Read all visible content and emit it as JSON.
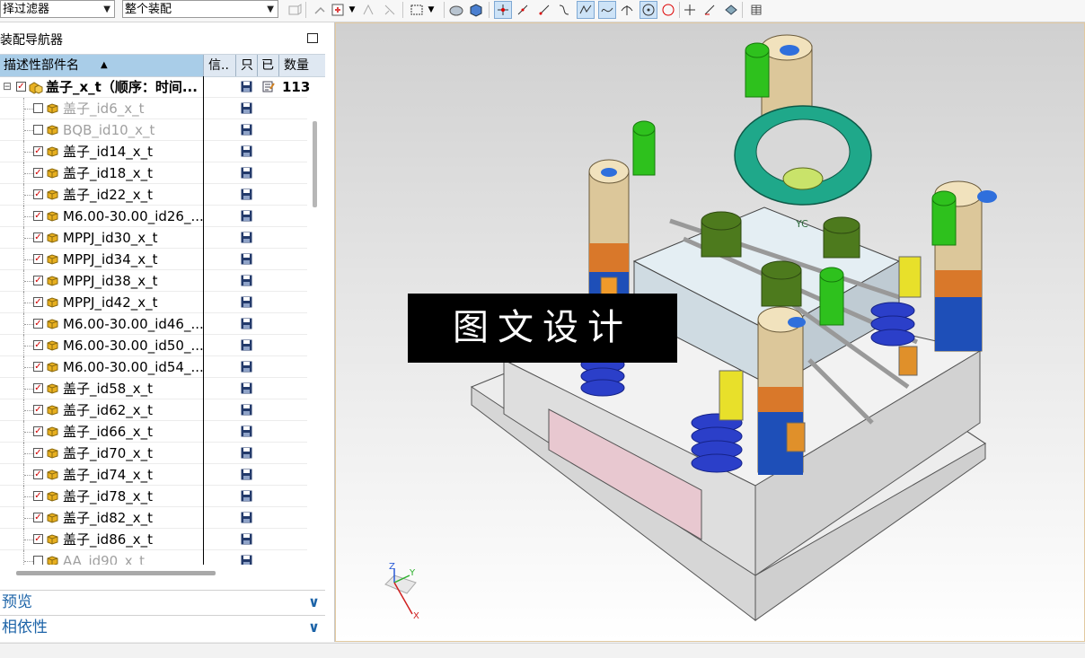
{
  "toolbar": {
    "filter_select": "择过滤器",
    "scope_select": "整个装配",
    "icons": [
      "view-icon",
      "select-icon",
      "filter-icon",
      "snap-icon",
      "box-select-icon",
      "dropdown-icon",
      "render-icon",
      "cube-icon",
      "snap-point-icon",
      "line-icon",
      "line2-icon",
      "curve-icon",
      "spline-icon",
      "wave-icon",
      "perpendicular-icon",
      "center-icon",
      "quadrant-icon",
      "intersection-icon",
      "angle-icon",
      "view-snap-icon",
      "grid-icon"
    ]
  },
  "navigator": {
    "title": "装配导航器",
    "columns": {
      "name": "描述性部件名",
      "info": "信..",
      "read_only": "只",
      "modified": "已",
      "count": "数量"
    },
    "root": {
      "label": "盖子_x_t（顺序：时间...",
      "count": "113"
    },
    "items": [
      {
        "label": "盖子_id6_x_t",
        "checked": false,
        "dim": true
      },
      {
        "label": "BQB_id10_x_t",
        "checked": false,
        "dim": true
      },
      {
        "label": "盖子_id14_x_t",
        "checked": true,
        "dim": false
      },
      {
        "label": "盖子_id18_x_t",
        "checked": true,
        "dim": false
      },
      {
        "label": "盖子_id22_x_t",
        "checked": true,
        "dim": false
      },
      {
        "label": "M6.00-30.00_id26_...",
        "checked": true,
        "dim": false
      },
      {
        "label": "MPPJ_id30_x_t",
        "checked": true,
        "dim": false
      },
      {
        "label": "MPPJ_id34_x_t",
        "checked": true,
        "dim": false
      },
      {
        "label": "MPPJ_id38_x_t",
        "checked": true,
        "dim": false
      },
      {
        "label": "MPPJ_id42_x_t",
        "checked": true,
        "dim": false
      },
      {
        "label": "M6.00-30.00_id46_...",
        "checked": true,
        "dim": false
      },
      {
        "label": "M6.00-30.00_id50_...",
        "checked": true,
        "dim": false
      },
      {
        "label": "M6.00-30.00_id54_...",
        "checked": true,
        "dim": false
      },
      {
        "label": "盖子_id58_x_t",
        "checked": true,
        "dim": false
      },
      {
        "label": "盖子_id62_x_t",
        "checked": true,
        "dim": false
      },
      {
        "label": "盖子_id66_x_t",
        "checked": true,
        "dim": false
      },
      {
        "label": "盖子_id70_x_t",
        "checked": true,
        "dim": false
      },
      {
        "label": "盖子_id74_x_t",
        "checked": true,
        "dim": false
      },
      {
        "label": "盖子_id78_x_t",
        "checked": true,
        "dim": false
      },
      {
        "label": "盖子_id82_x_t",
        "checked": true,
        "dim": false
      },
      {
        "label": "盖子_id86_x_t",
        "checked": true,
        "dim": false
      },
      {
        "label": "AA_id90_x_t",
        "checked": false,
        "dim": true
      }
    ],
    "sections": {
      "preview": "预览",
      "dependencies": "相依性"
    }
  },
  "viewport": {
    "watermark": "图文设计",
    "csys_label": "YC",
    "triad": {
      "x": "X",
      "y": "Y",
      "z": "Z"
    }
  },
  "colors": {
    "header_blue": "#a9cde8",
    "section_blue": "#1d64a8",
    "check_red": "#d00000",
    "bolt_green": "#2ec11d",
    "ring_teal": "#1fa88a",
    "pillar_tan": "#dcc79a",
    "pillar_blue": "#1e4fb8",
    "spring_blue": "#2b3fc9",
    "plate_grey": "#e9eef2"
  }
}
